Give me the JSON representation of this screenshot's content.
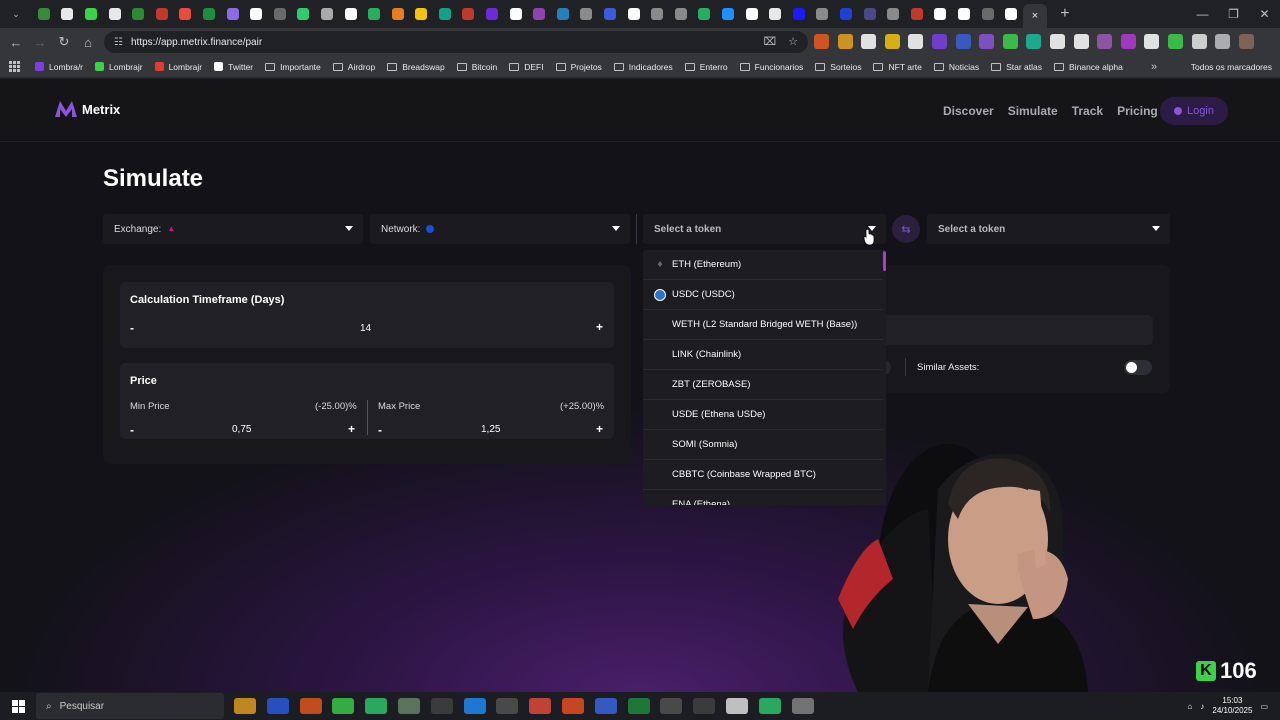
{
  "browser": {
    "url": "https://app.metrix.finance/pair",
    "tab_close": "×",
    "new_tab": "+",
    "window_controls": [
      "—",
      "❐",
      "✕"
    ],
    "bookmarks": [
      {
        "label": "Lombra/r",
        "type": "site",
        "color": "#7b3fe4"
      },
      {
        "label": "Lombrajr",
        "type": "site",
        "color": "#3bd14b"
      },
      {
        "label": "Lombrajr",
        "type": "site",
        "color": "#e53935"
      },
      {
        "label": "Twitter",
        "type": "site",
        "color": "#ffffff"
      },
      {
        "label": "Importante",
        "type": "folder"
      },
      {
        "label": "Airdrop",
        "type": "folder"
      },
      {
        "label": "Breadswap",
        "type": "folder"
      },
      {
        "label": "Bitcoin",
        "type": "folder"
      },
      {
        "label": "DEFI",
        "type": "folder"
      },
      {
        "label": "Projetos",
        "type": "folder"
      },
      {
        "label": "Indicadores",
        "type": "folder"
      },
      {
        "label": "Enterro",
        "type": "folder"
      },
      {
        "label": "Funcionarios",
        "type": "folder"
      },
      {
        "label": "Sorteios",
        "type": "folder"
      },
      {
        "label": "NFT arte",
        "type": "folder"
      },
      {
        "label": "Noticias",
        "type": "folder"
      },
      {
        "label": "Star atlas",
        "type": "folder"
      },
      {
        "label": "Binance alpha",
        "type": "folder"
      }
    ],
    "bookmarks_more": "»",
    "all_bookmarks": "Todos os marcadores"
  },
  "site": {
    "logo_text": "Metrix",
    "nav": [
      "Discover",
      "Simulate",
      "Track",
      "Pricing"
    ],
    "login_label": "Login"
  },
  "page": {
    "title": "Simulate",
    "exchange_label": "Exchange:",
    "network_label": "Network:",
    "token_a_placeholder": "Select a token",
    "token_b_placeholder": "Select a token",
    "timeframe": {
      "label": "Calculation Timeframe (Days)",
      "value": "14",
      "minus": "-",
      "plus": "+"
    },
    "price": {
      "label": "Price",
      "min_label": "Min Price",
      "min_pct": "(-25.00)%",
      "min_value": "0,75",
      "max_label": "Max Price",
      "max_pct": "(+25.00)%",
      "max_value": "1,25",
      "minus": "-",
      "plus": "+"
    },
    "similar_assets_label": "Similar Assets:",
    "similar_assets_enabled": false
  },
  "token_dropdown": {
    "items": [
      {
        "label": "ETH (Ethereum)",
        "icon": "eth-icon",
        "color": "#6b6b78"
      },
      {
        "label": "USDC (USDC)",
        "icon": "usdc-icon",
        "color": "#2775ca"
      },
      {
        "label": "WETH (L2 Standard Bridged WETH (Base))",
        "icon": "",
        "color": ""
      },
      {
        "label": "LINK (Chainlink)",
        "icon": "",
        "color": ""
      },
      {
        "label": "ZBT (ZEROBASE)",
        "icon": "",
        "color": ""
      },
      {
        "label": "USDE (Ethena USDe)",
        "icon": "",
        "color": ""
      },
      {
        "label": "SOMI (Somnia)",
        "icon": "",
        "color": ""
      },
      {
        "label": "CBBTC (Coinbase Wrapped BTC)",
        "icon": "",
        "color": ""
      },
      {
        "label": "ENA (Ethena)",
        "icon": "",
        "color": ""
      }
    ]
  },
  "overlay": {
    "counter": "106",
    "counter_badge": "K"
  },
  "taskbar": {
    "search_placeholder": "Pesquisar",
    "time": "15:03",
    "date": "24/10/2025"
  },
  "colors": {
    "accent": "#8a55d8",
    "scrollbar": "#b13ad6",
    "background": "#121218"
  }
}
